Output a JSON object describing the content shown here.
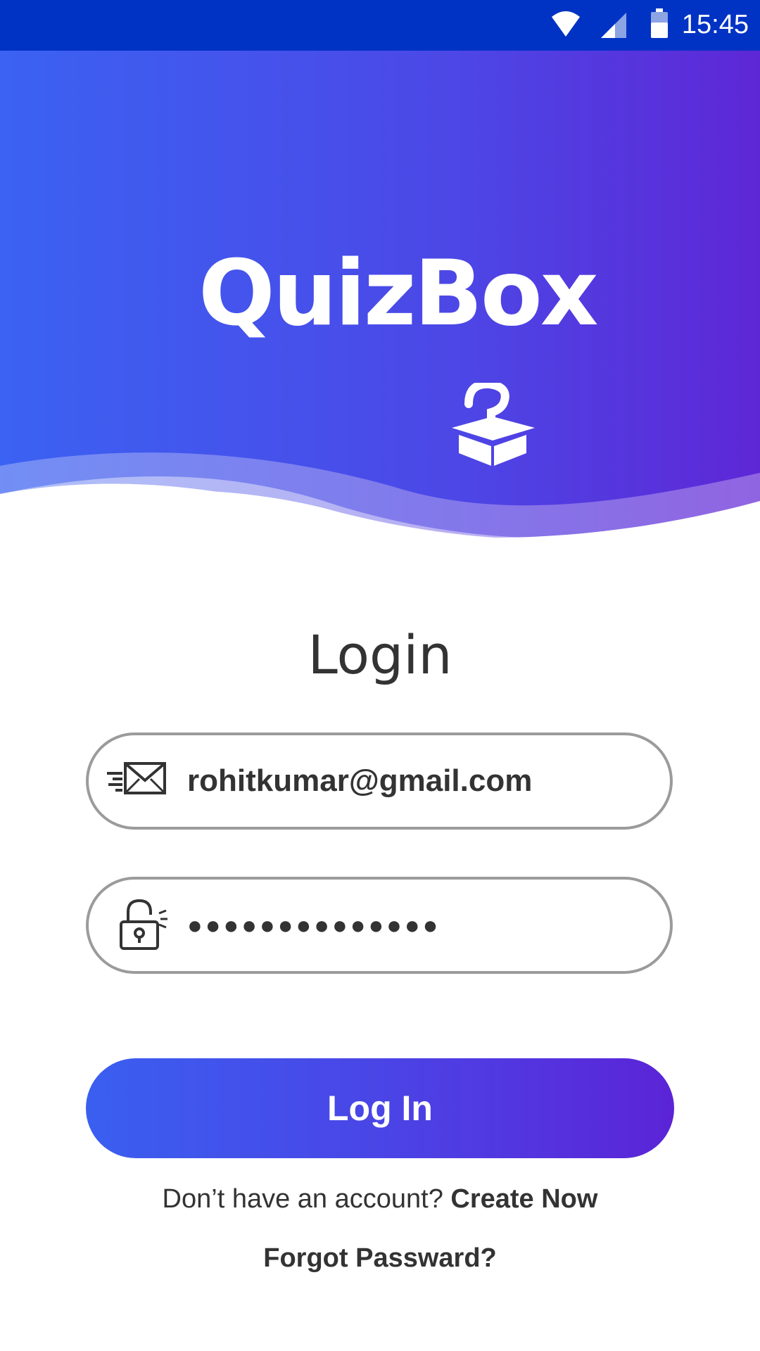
{
  "status_bar": {
    "time": "15:45",
    "icons": [
      "wifi-icon",
      "signal-icon",
      "battery-icon"
    ],
    "background": "#0033c4"
  },
  "brand": {
    "name": "QuizBox",
    "logo_icon": "question-box-icon",
    "gradient_start": "#3b62f2",
    "gradient_end": "#5e27d6"
  },
  "login": {
    "title": "Login",
    "email": {
      "icon": "mail-icon",
      "value": "rohitkumar@gmail.com"
    },
    "password": {
      "icon": "unlock-icon",
      "value": "●●●●●●●●●●●●●●"
    },
    "submit_label": "Log In",
    "no_account_text": "Don’t have an account? ",
    "create_now_label": "Create Now",
    "forgot_label": "Forgot Passward?"
  }
}
